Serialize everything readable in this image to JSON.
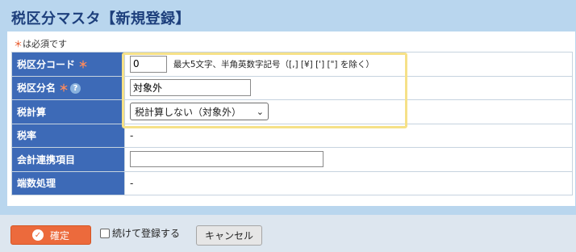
{
  "page": {
    "title": "税区分マスタ【新規登録】"
  },
  "required_note": {
    "star": "＊",
    "text": "は必須です"
  },
  "form": {
    "tax_code": {
      "label": "税区分コード",
      "value": "0",
      "hint": "最大5文字、半角英数字記号（[,] [¥] ['] [\"] を除く）"
    },
    "tax_name": {
      "label": "税区分名",
      "value": "対象外"
    },
    "tax_calc": {
      "label": "税計算",
      "selected": "税計算しない（対象外）"
    },
    "tax_rate": {
      "label": "税率",
      "value": "-"
    },
    "account_link": {
      "label": "会計連携項目",
      "value": ""
    },
    "rounding": {
      "label": "端数処理",
      "value": "-"
    },
    "required_star": "＊",
    "help_glyph": "?"
  },
  "footer": {
    "confirm_label": "確定",
    "confirm_icon": "✓",
    "continue_label": "続けて登録する",
    "cancel_label": "キャンセル"
  },
  "colors": {
    "background": "#b9d6ee",
    "header_cell": "#3d6ab7",
    "title": "#1d3f7c",
    "accent": "#ec6a3c",
    "highlight": "#f6e188"
  }
}
